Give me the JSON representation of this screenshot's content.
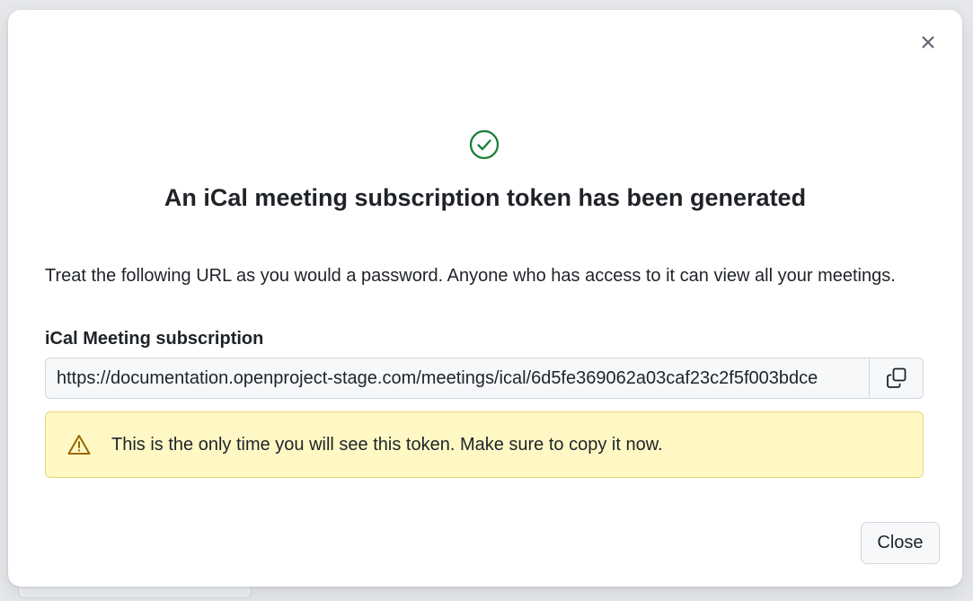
{
  "colors": {
    "success": "#1a7f37",
    "warning_icon": "#9a6700",
    "warning_bg": "#fff8c5",
    "text": "#1f2328",
    "muted_icon": "#59636e"
  },
  "dialog": {
    "close_icon": "close-icon",
    "status_icon": "check-circle-icon",
    "title": "An iCal meeting subscription token has been generated",
    "description": "Treat the following URL as you would a password. Anyone who has access to it can view all your meetings.",
    "field_label": "iCal Meeting subscription",
    "url_value": "https://documentation.openproject-stage.com/meetings/ical/6d5fe369062a03caf23c2f5f003bdce",
    "copy_icon": "copy-icon",
    "warning_icon": "alert-triangle-icon",
    "warning_text": "This is the only time you will see this token. Make sure to copy it now.",
    "close_button_label": "Close"
  }
}
